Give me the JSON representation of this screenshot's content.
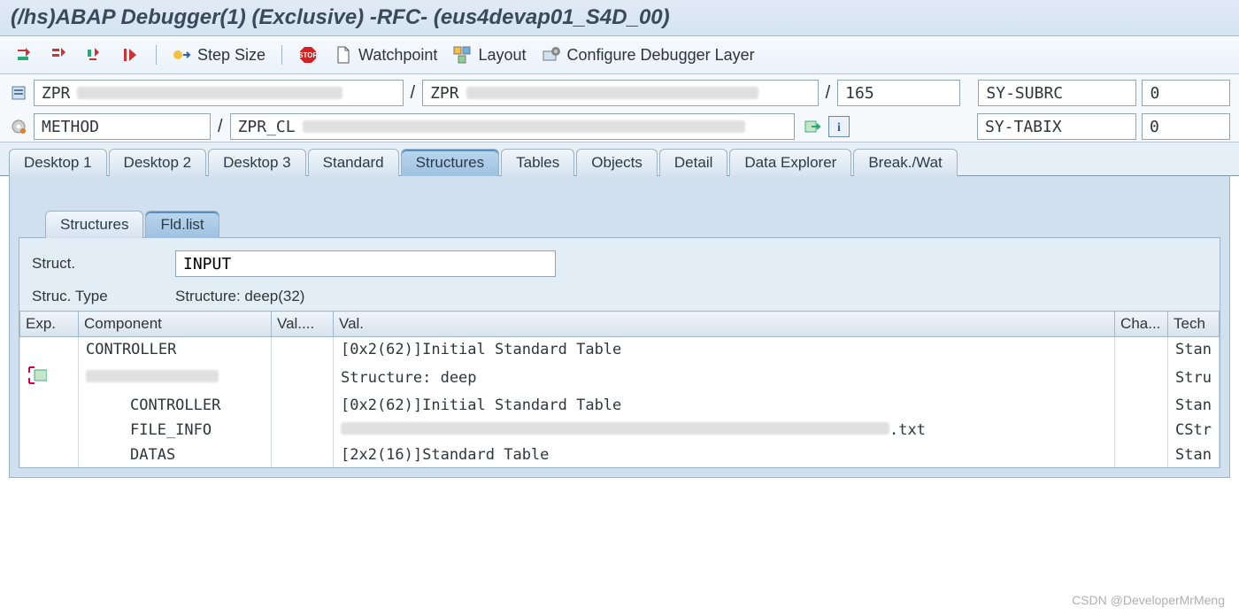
{
  "title": "(/hs)ABAP Debugger(1)  (Exclusive) -RFC- (eus4devap01_S4D_00)",
  "toolbar": {
    "step_size": "Step Size",
    "watchpoint": "Watchpoint",
    "layout": "Layout",
    "config": "Configure Debugger Layer"
  },
  "location": {
    "row1": {
      "prog1": "ZPR",
      "prog2": "ZPR",
      "line": "165",
      "sysvar": "SY-SUBRC",
      "sysval": "0"
    },
    "row2": {
      "event": "METHOD",
      "method": "ZPR_CL",
      "sysvar": "SY-TABIX",
      "sysval": "0"
    }
  },
  "main_tabs": [
    "Desktop 1",
    "Desktop 2",
    "Desktop 3",
    "Standard",
    "Structures",
    "Tables",
    "Objects",
    "Detail",
    "Data Explorer",
    "Break./Wat"
  ],
  "main_active": 4,
  "sub_tabs": [
    "Structures",
    "Fld.list"
  ],
  "sub_active": 1,
  "form": {
    "struct_label": "Struct.",
    "struct_value": "INPUT",
    "type_label": "Struc. Type",
    "type_value": "Structure: deep(32)"
  },
  "columns": {
    "exp": "Exp.",
    "component": "Component",
    "valtype": "Val....",
    "val": "Val.",
    "cha": "Cha...",
    "tech": "Tech"
  },
  "rows": [
    {
      "indent": 0,
      "exp": "",
      "component": "CONTROLLER",
      "val": "[0x2(62)]Initial Standard Table",
      "tech": "Stan"
    },
    {
      "indent": 0,
      "exp": "ic",
      "component": "__redacted",
      "val": "Structure: deep",
      "tech": "Stru"
    },
    {
      "indent": 1,
      "exp": "",
      "component": "CONTROLLER",
      "val": "[0x2(62)]Initial Standard Table",
      "tech": "Stan"
    },
    {
      "indent": 1,
      "exp": "",
      "component": "FILE_INFO",
      "val": "__redacted_txt",
      "tech": "CStr"
    },
    {
      "indent": 1,
      "exp": "",
      "component": "DATAS",
      "val": "[2x2(16)]Standard Table",
      "tech": "Stan"
    }
  ],
  "watermark": "CSDN @DeveloperMrMeng"
}
